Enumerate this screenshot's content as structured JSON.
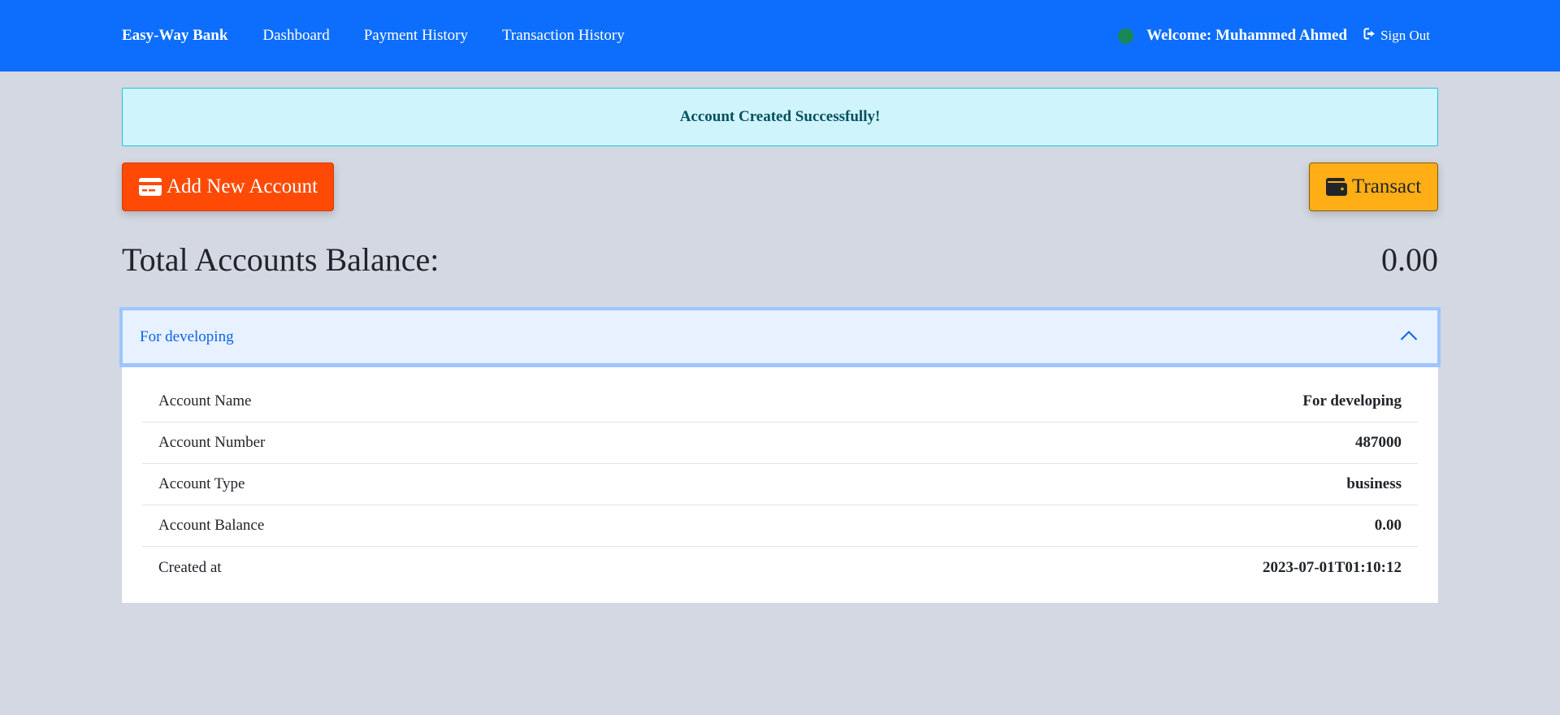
{
  "navbar": {
    "brand": "Easy-Way Bank",
    "links": [
      "Dashboard",
      "Payment History",
      "Transaction History"
    ],
    "welcome": "Welcome: Muhammed Ahmed",
    "signout": "Sign Out",
    "status_color": "#198754"
  },
  "alert": {
    "message": "Account Created Successfully!"
  },
  "buttons": {
    "add_account": "Add New Account",
    "transact": "Transact"
  },
  "balance": {
    "label": "Total Accounts Balance:",
    "value": "0.00"
  },
  "accordion": {
    "title": "For developing",
    "expanded": true,
    "rows": [
      {
        "label": "Account Name",
        "value": "For developing"
      },
      {
        "label": "Account Number",
        "value": "487000"
      },
      {
        "label": "Account Type",
        "value": "business"
      },
      {
        "label": "Account Balance",
        "value": "0.00"
      },
      {
        "label": "Created at",
        "value": "2023-07-01T01:10:12"
      }
    ]
  },
  "colors": {
    "primary": "#0d6efd",
    "danger_orange": "#ff4a06",
    "warning": "#ffae15",
    "info_bg": "#cff4fc"
  }
}
